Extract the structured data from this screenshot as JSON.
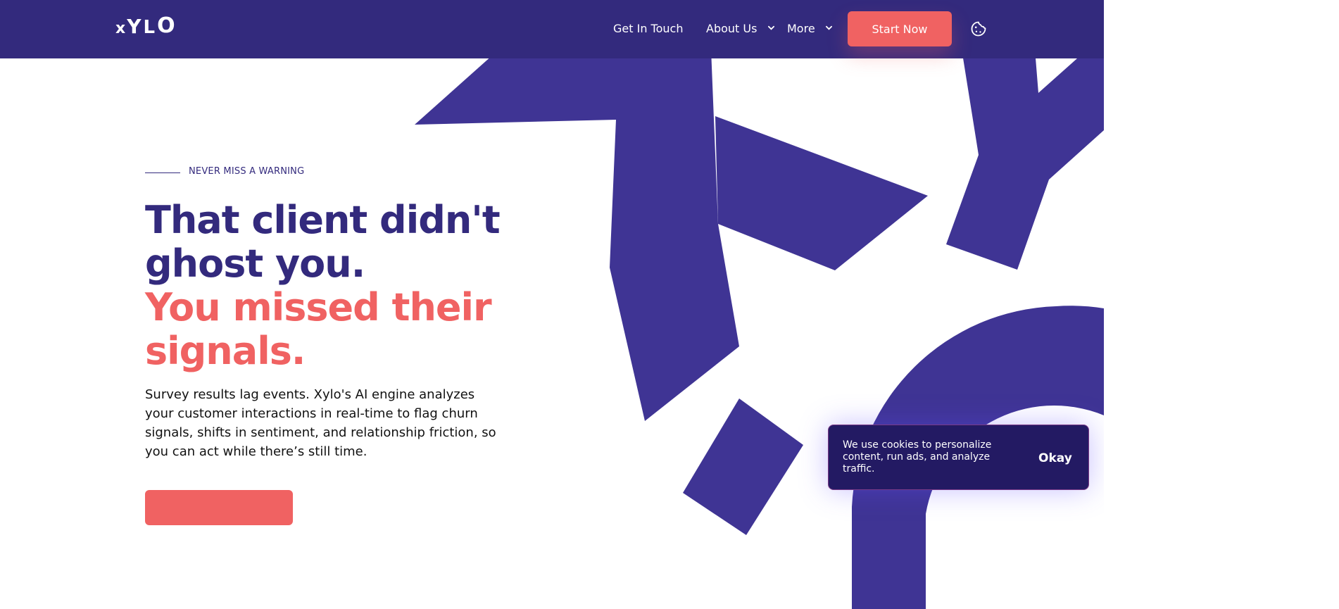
{
  "brand": {
    "logo_x": "x",
    "logo_y": "Y",
    "logo_l": "L",
    "logo_o": "O",
    "primary": "#332a7d",
    "accent": "#f06262",
    "graphic": "#3f3494"
  },
  "navbar": {
    "items": [
      {
        "label": "Get In Touch"
      },
      {
        "label": "About Us",
        "icon": "chevron-down-icon"
      },
      {
        "label": "More",
        "icon": "chevron-down-icon"
      }
    ],
    "start_label": "Start Now",
    "cookie_icon": "cookie-icon"
  },
  "hero": {
    "eyebrow": "NEVER MISS A WARNING",
    "headline_primary": "That client didn't ghost you.",
    "headline_accent": "You missed their signals.",
    "description": "Survey results lag events. Xylo's AI engine analyzes your customer interactions in real-time to flag churn signals, shifts in sentiment, and relationship friction, so you can act while there’s still time.",
    "cta_label": ""
  },
  "cookie_notice": {
    "message": "We use cookies to personalize content, run ads, and analyze traffic.",
    "button_label": "Okay"
  }
}
